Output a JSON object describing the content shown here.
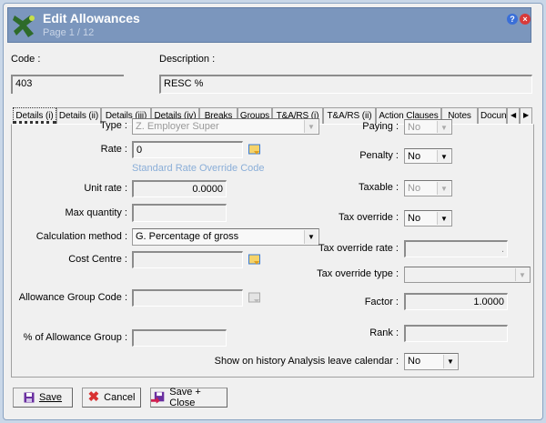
{
  "header": {
    "title": "Edit Allowances",
    "page": "Page 1 / 12"
  },
  "code": {
    "label": "Code :",
    "value": "403"
  },
  "description": {
    "label": "Description :",
    "value": "RESC %"
  },
  "tabs": [
    "Details (i)",
    "Details (ii)",
    "Details (iii)",
    "Details (iv)",
    "Breaks",
    "Groups",
    "T&A/RS (i)",
    "T&A/RS (ii)",
    "Action Clauses",
    "Notes",
    "Docun"
  ],
  "left": {
    "type": {
      "label": "Type :",
      "value": "Z. Employer Super"
    },
    "rate": {
      "label": "Rate :",
      "value": "0",
      "link": "Standard Rate Override Code"
    },
    "unit_rate": {
      "label": "Unit rate :",
      "value": "0.0000"
    },
    "max_quantity": {
      "label": "Max quantity :",
      "value": ""
    },
    "calc_method": {
      "label": "Calculation method :",
      "value": "G. Percentage of gross"
    },
    "cost_centre": {
      "label": "Cost Centre :",
      "value": ""
    },
    "allowance_group_code": {
      "label": "Allowance Group Code :",
      "value": ""
    },
    "pct_allowance_group": {
      "label": "% of Allowance Group :",
      "value": ""
    }
  },
  "right": {
    "paying": {
      "label": "Paying :",
      "value": "No"
    },
    "penalty": {
      "label": "Penalty :",
      "value": "No"
    },
    "taxable": {
      "label": "Taxable :",
      "value": "No"
    },
    "tax_override": {
      "label": "Tax override :",
      "value": "No"
    },
    "tax_override_rate": {
      "label": "Tax override rate :",
      "value": "."
    },
    "tax_override_type": {
      "label": "Tax override type :",
      "value": ""
    },
    "factor": {
      "label": "Factor :",
      "value": "1.0000"
    },
    "rank": {
      "label": "Rank :",
      "value": ""
    },
    "show_history": {
      "label": "Show on history Analysis leave calendar :",
      "value": "No"
    }
  },
  "buttons": {
    "save": "Save",
    "cancel": "Cancel",
    "save_close": "Save + Close"
  }
}
